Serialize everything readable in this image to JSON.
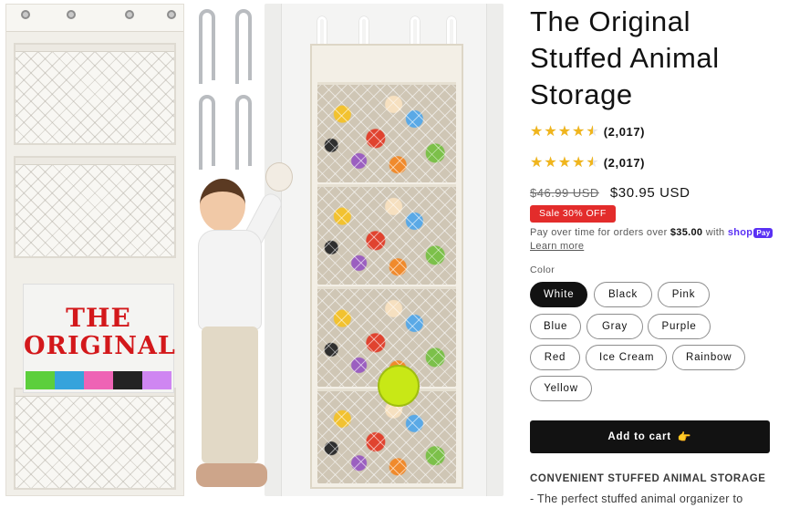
{
  "product": {
    "title_lines": [
      "The Original",
      "Stuffed Animal",
      "Storage"
    ],
    "rating_fraction": 0.9,
    "rating_count": "(2,017)",
    "rating_count_2": "(2,017)",
    "price_regular": "$46.99 USD",
    "price_sale": "$30.95 USD",
    "sale_badge": "Sale 30% OFF"
  },
  "installments": {
    "text_before": "Pay over time for orders over ",
    "amount": "$35.00",
    "text_after": " with ",
    "shop": "shop",
    "pay": "Pay",
    "learn_more": "Learn more"
  },
  "variant": {
    "label": "Color",
    "options": [
      "White",
      "Black",
      "Pink",
      "Blue",
      "Gray",
      "Purple",
      "Red",
      "Ice Cream",
      "Rainbow",
      "Yellow"
    ],
    "selected": "White"
  },
  "cart": {
    "button_label": "Add to cart",
    "button_icon": "👉"
  },
  "description": {
    "heading": "CONVENIENT STUFFED ANIMAL STORAGE",
    "first_line": "- The perfect stuffed animal organizer to"
  },
  "gallery": {
    "organizer_label_line1": "THE",
    "organizer_label_line2": "ORIGINAL",
    "label_swatch_colors": [
      "#5ccf3c",
      "#36a3dc",
      "#ee63b5",
      "#232323",
      "#cf86f2"
    ]
  },
  "colors": {
    "star": "#f0b51d",
    "sale_badge": "#e32c2b",
    "shop_pay": "#5a31f4",
    "button": "#121212"
  }
}
